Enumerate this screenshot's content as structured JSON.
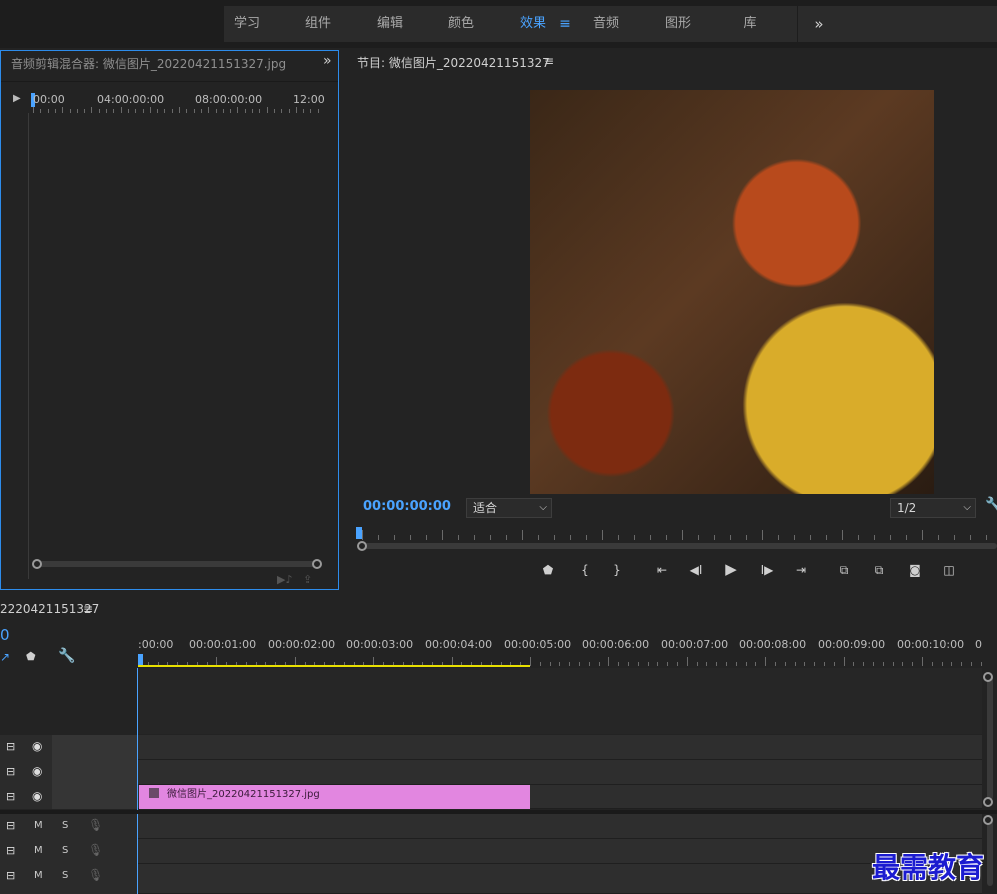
{
  "workspace": {
    "tabs": [
      {
        "label": "学习"
      },
      {
        "label": "组件"
      },
      {
        "label": "编辑"
      },
      {
        "label": "颜色"
      },
      {
        "label": "效果"
      },
      {
        "label": "音频"
      },
      {
        "label": "图形"
      },
      {
        "label": "库"
      }
    ],
    "active_tab": "效果",
    "more_glyph": "»"
  },
  "mixer": {
    "title": "音频剪辑混合器: 微信图片_20220421151327.jpg",
    "more_glyph": "»",
    "timecodes": [
      "00:00",
      "04:00:00:00",
      "08:00:00:00",
      "12:00"
    ]
  },
  "program": {
    "title": "节目: 微信图片_20220421151327",
    "timecode": "00:00:00:00",
    "fit_label": "适合",
    "resolution": "1/2"
  },
  "timeline": {
    "title": "2220421151327",
    "left_timecode_fragment": "0",
    "ruler": [
      ":00:00",
      "00:00:01:00",
      "00:00:02:00",
      "00:00:03:00",
      "00:00:04:00",
      "00:00:05:00",
      "00:00:06:00",
      "00:00:07:00",
      "00:00:08:00",
      "00:00:09:00",
      "00:00:10:00",
      "0"
    ],
    "clip_name": "微信图片_20220421151327.jpg",
    "audio_letters": {
      "m": "M",
      "s": "S"
    }
  },
  "watermark": "最需教育",
  "colors": {
    "accent": "#4aa3ff",
    "clip": "#e286e0",
    "work_area": "#e8e000"
  }
}
